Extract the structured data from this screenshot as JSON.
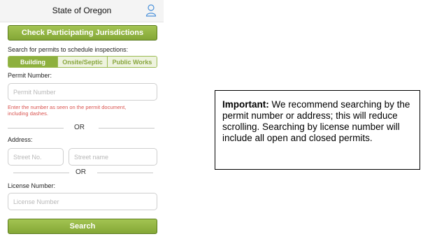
{
  "header": {
    "title": "State of Oregon",
    "icon": "user-icon"
  },
  "jurisdictions_button": "Check Participating Jurisdictions",
  "search_for_label": "Search for permits to schedule inspections:",
  "tabs": [
    {
      "label": "Building",
      "active": true
    },
    {
      "label": "Onsite/Septic",
      "active": false
    },
    {
      "label": "Public Works",
      "active": false
    }
  ],
  "permit": {
    "label": "Permit Number:",
    "placeholder": "Permit Number",
    "hint": "Enter the number as seen on the permit document, including dashes."
  },
  "or_text": "OR",
  "address": {
    "label": "Address:",
    "street_no_placeholder": "Street No.",
    "street_name_placeholder": "Street name"
  },
  "license": {
    "label": "License Number:",
    "placeholder": "License Number"
  },
  "search_button": "Search",
  "note": {
    "bold": "Important:",
    "text": " We recommend searching by the permit number or address; this will reduce scrolling. Searching by license number will include all open and closed permits."
  },
  "colors": {
    "accent_green": "#8db03e",
    "hint_red": "#d9534f"
  }
}
